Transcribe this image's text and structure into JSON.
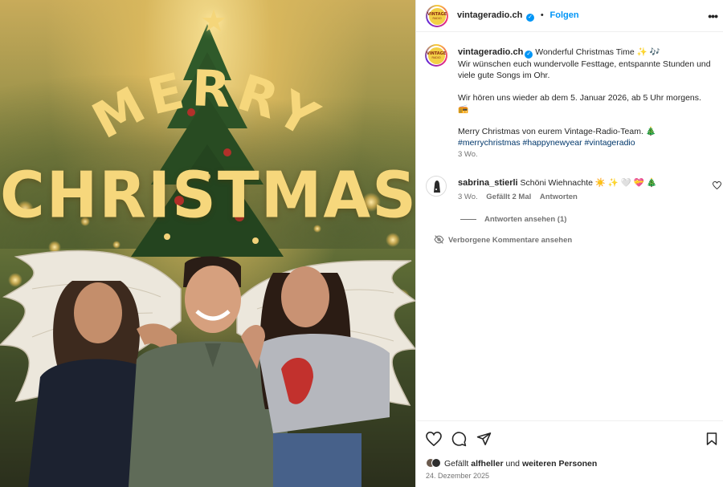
{
  "post": {
    "account": "vintageradio.ch",
    "follow_label": "Folgen",
    "separator": "•",
    "more_icon": "more-options-icon",
    "avatar_logo": {
      "line1": "VINTAGE",
      "line2": "RADIO"
    },
    "image": {
      "line1": "MERRY",
      "line2": "CHRISTMAS"
    }
  },
  "caption": {
    "username": "vintageradio.ch",
    "line1": "Wonderful Christmas Time ✨ 🎶",
    "line2": "Wir wünschen euch wundervolle Festtage, entspannte Stunden und viele gute Songs im Ohr.",
    "line3": "Wir hören uns wieder ab dem 5. Januar 2026, ab 5 Uhr morgens. 📻",
    "line4": "Merry Christmas von eurem Vintage-Radio-Team. 🎄",
    "hashtags": "#merrychristmas #happynewyear #vintageradio",
    "time": "3 Wo."
  },
  "comment": {
    "username": "sabrina_stierli",
    "text": "Schöni Wiehnachte ☀️ ✨ 🤍 💝 🎄",
    "time": "3 Wo.",
    "likes": "Gefällt 2 Mal",
    "reply": "Antworten",
    "view_replies": "Antworten ansehen (1)"
  },
  "hidden_comments": "Verborgene Kommentare ansehen",
  "footer": {
    "liked_prefix": "Gefällt",
    "liked_by": "alfheller",
    "liked_and": "und",
    "liked_others": "weiteren Personen",
    "date": "24. Dezember 2025"
  },
  "colors": {
    "accent": "#0095f6",
    "link": "#00376b",
    "muted": "#737373",
    "title_gold": "#f6d77c"
  }
}
